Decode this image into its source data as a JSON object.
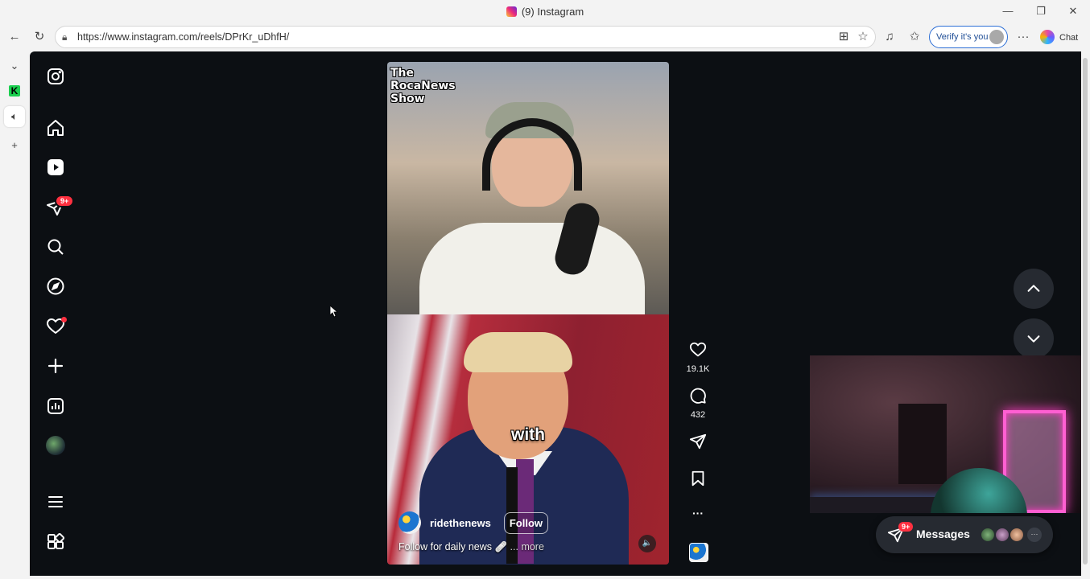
{
  "window": {
    "title": "(9) Instagram",
    "minimize": "—",
    "restore": "❐",
    "close": "✕"
  },
  "toolbar": {
    "url": "https://www.instagram.com/reels/DPrKr_uDhfH/",
    "verify_label": "Verify it's you",
    "chat_label": "Chat",
    "more_label": "···"
  },
  "reel": {
    "show_logo_line1": "The",
    "show_logo_line2": "RocaNews",
    "show_logo_line3": "Show",
    "caption_word": "with",
    "username": "ridethenews",
    "follow_label": "Follow",
    "description": "Follow for daily news 🩹",
    "more_label": "... more",
    "mute_icon": "🔈"
  },
  "actions": {
    "likes": "19.1K",
    "comments": "432",
    "more_label": "···"
  },
  "nav": {
    "notifications_badge": "9+"
  },
  "messages": {
    "label": "Messages",
    "badge": "9+",
    "more_label": "···"
  },
  "colors": {
    "ig_background": "#0c0f13",
    "badge_red": "#ff3040",
    "verify_blue": "#2d6fd6",
    "neon_pink": "#ff5fd2"
  }
}
